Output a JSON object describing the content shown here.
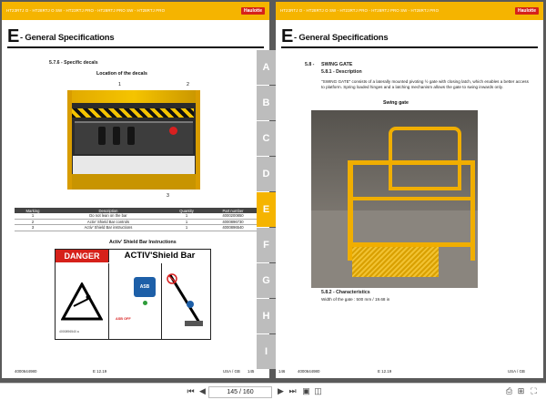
{
  "brand": "Haulotte",
  "header_models": "HT23RTJ O - HT28RTJ O SW - HT23RTJ PRO - HT28RTJ PRO SW - HT28RTJ PRO",
  "left_page": {
    "title_letter": "E",
    "title_text": "- General Specifications",
    "section": "5.7.6 - Specific decals",
    "location_caption": "Location of the  decals",
    "callouts": [
      "1",
      "2",
      "3"
    ],
    "table": {
      "headers": [
        "Marking",
        "Description",
        "Quantity",
        "Part number"
      ],
      "rows": [
        [
          "1",
          "Do not lean on the bar",
          "1",
          "4000200850"
        ],
        [
          "2",
          "Activ' Shield Bar controls",
          "1",
          "4000896730"
        ],
        [
          "3",
          "Activ' Shield Bar instructions",
          "1",
          "4000896540"
        ]
      ]
    },
    "instructions_caption": "Activ' Shield Bar Instructions",
    "decal": {
      "danger": "DANGER",
      "shield": "ACTIV'Shield Bar",
      "asb": "ASB",
      "asb_off": "ASB OFF",
      "ref": "4000896540 a"
    },
    "footer_left": "4000644980",
    "footer_center": "E 12.19",
    "footer_region": "USA / GB",
    "footer_page": "145"
  },
  "tabs": [
    "A",
    "B",
    "C",
    "D",
    "E",
    "F",
    "G",
    "H",
    "I"
  ],
  "active_tab": "E",
  "right_page": {
    "title_letter": "E",
    "title_text": "- General Specifications",
    "section_num": "5.8 -",
    "section_title": "SWING GATE",
    "sub1": "5.8.1 - Description",
    "description": "\"SWING GATE\" consists of a laterally mounted pivoting ½ gate with closing latch, which enables a better access to platform. Spring loaded hinges and a latching mechanism allows the gate to swing inwards only.",
    "photo_caption": "Swing gate",
    "sub2": "5.8.2 - Characteristics",
    "width_text": "Width of the gate :  500 mm / 19.68 in",
    "footer_page": "146",
    "footer_left": "4000644980",
    "footer_center": "E 12.19",
    "footer_region": "USA / GB"
  },
  "toolbar": {
    "page_display": "145 / 160"
  }
}
